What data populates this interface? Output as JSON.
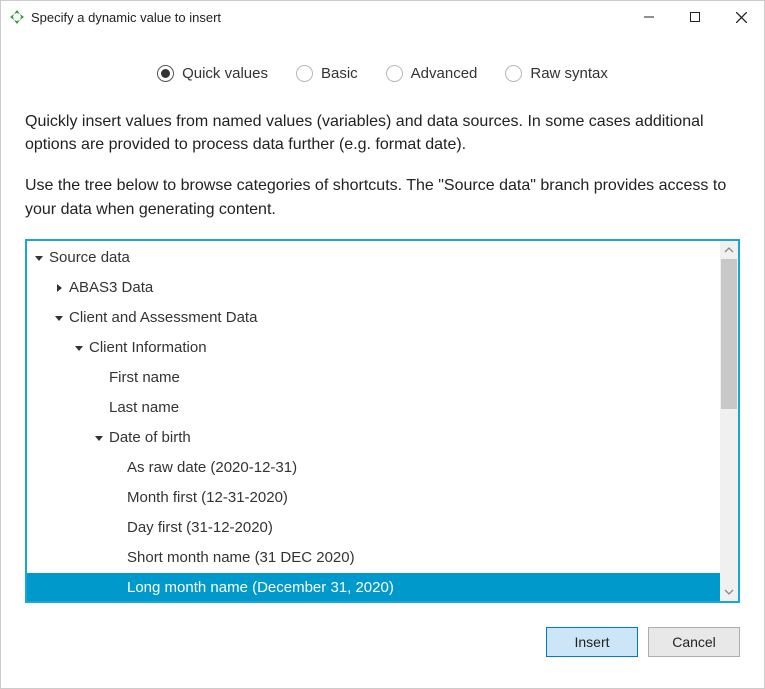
{
  "window": {
    "title": "Specify a dynamic value to insert"
  },
  "tabs": {
    "quick": "Quick values",
    "basic": "Basic",
    "advanced": "Advanced",
    "raw": "Raw syntax",
    "selected": "quick"
  },
  "description": {
    "p1": "Quickly insert values from named values (variables) and data sources. In some cases additional options are provided to process data further (e.g. format date).",
    "p2": "Use the tree below to browse categories of shortcuts. The \"Source data\" branch provides access to your data when generating content."
  },
  "tree": {
    "rows": [
      {
        "label": "Source data",
        "indent": 0,
        "disclosure": "down"
      },
      {
        "label": "ABAS3 Data",
        "indent": 1,
        "disclosure": "right"
      },
      {
        "label": "Client and Assessment Data",
        "indent": 1,
        "disclosure": "down"
      },
      {
        "label": "Client Information",
        "indent": 2,
        "disclosure": "down"
      },
      {
        "label": "First name",
        "indent": 3,
        "disclosure": "none",
        "leaf": true
      },
      {
        "label": "Last name",
        "indent": 3,
        "disclosure": "none",
        "leaf": true
      },
      {
        "label": "Date of birth",
        "indent": 3,
        "disclosure": "down"
      },
      {
        "label": "As raw date (2020-12-31)",
        "indent": 4,
        "disclosure": "none"
      },
      {
        "label": "Month first (12-31-2020)",
        "indent": 4,
        "disclosure": "none"
      },
      {
        "label": "Day first (31-12-2020)",
        "indent": 4,
        "disclosure": "none"
      },
      {
        "label": "Short month name (31 DEC 2020)",
        "indent": 4,
        "disclosure": "none"
      },
      {
        "label": "Long month name (December 31, 2020)",
        "indent": 4,
        "disclosure": "none",
        "selected": true
      }
    ]
  },
  "buttons": {
    "insert": "Insert",
    "cancel": "Cancel"
  }
}
